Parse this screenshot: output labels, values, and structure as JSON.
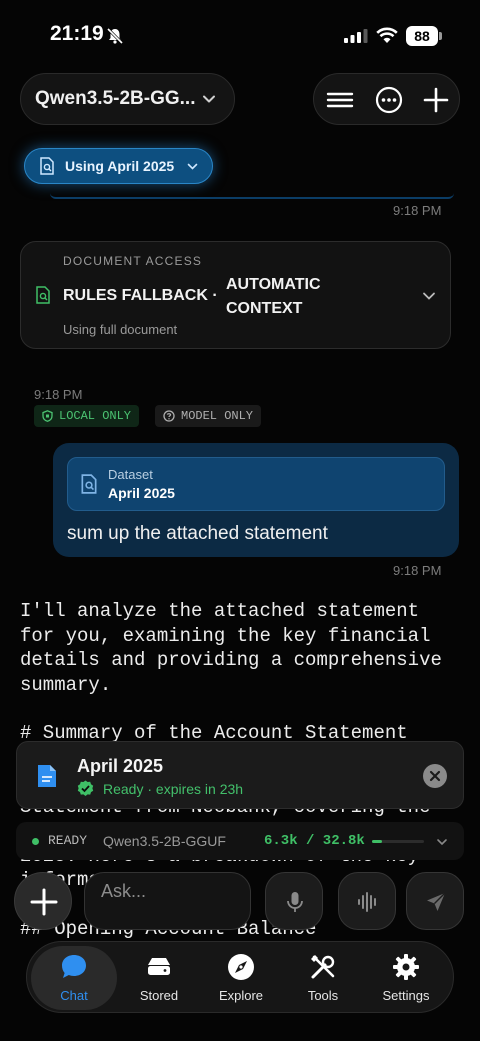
{
  "status_bar": {
    "time": "21:19",
    "battery": "88"
  },
  "header": {
    "model_name": "Qwen3.5-2B-GG..."
  },
  "context_chip": {
    "label": "Using April 2025"
  },
  "timestamps": {
    "t1": "9:18 PM",
    "t2": "9:18 PM",
    "t3": "9:18 PM"
  },
  "doc_access": {
    "caption": "DOCUMENT ACCESS",
    "title_part1": "RULES FALLBACK ·",
    "title_part2": "AUTOMATIC CONTEXT",
    "subtitle": "Using full document"
  },
  "badges": {
    "local": "LOCAL ONLY",
    "model": "MODEL ONLY"
  },
  "user_message": {
    "attachment_caption": "Dataset",
    "attachment_name": "April 2025",
    "text": "sum up the attached statement"
  },
  "assistant": {
    "line1": "I'll analyze the attached statement",
    "line2": "for you, examining the key financial",
    "line3": "details and providing a comprehensive",
    "line4": "summary.",
    "line5": "# Summary of the Account Statement",
    "line6": "Statement from Neobank, covering the",
    "line7": "2025. Here's a breakdown of the key",
    "line8": "informa",
    "line9": "## Opening Account Balance"
  },
  "file_card": {
    "name": "April 2025",
    "status": "Ready · expires in 23h"
  },
  "ready_bar": {
    "state": "READY",
    "model": "Qwen3.5-2B-GGUF",
    "tokens": "6.3k / 32.8k",
    "usage_fraction": 0.19
  },
  "composer": {
    "placeholder": "Ask..."
  },
  "tabs": [
    {
      "label": "Chat"
    },
    {
      "label": "Stored"
    },
    {
      "label": "Explore"
    },
    {
      "label": "Tools"
    },
    {
      "label": "Settings"
    }
  ],
  "colors": {
    "accent": "#2f8ff0",
    "success": "#3fbf66",
    "chip": "#0d4f80"
  }
}
